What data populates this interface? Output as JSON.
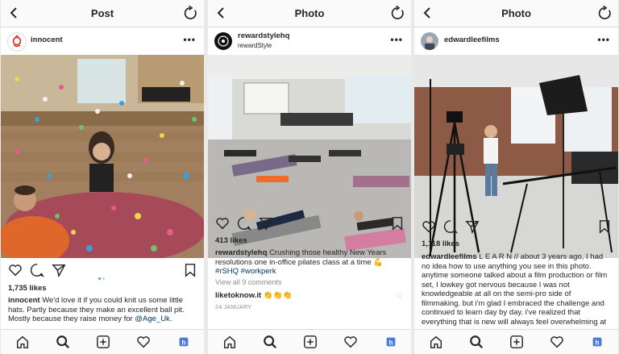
{
  "panels": [
    {
      "header_title": "Post",
      "username": "innocent",
      "likes": "1,735 likes",
      "caption_user": "innocent",
      "caption_text": "We'd love it if you could knit us some little hats. Partly because they make an excellent ball pit. Mostly because they raise money for",
      "caption_tag": "@Age_Uk",
      "caption_end": "."
    },
    {
      "header_title": "Photo",
      "username": "rewardstylehq",
      "subtitle": "rewardStyle",
      "likes": "413 likes",
      "caption_user": "rewardstylehq",
      "caption_text": "Crushing those healthy New Years resolutions one in-office pilates class at a time",
      "caption_tags": "#rSHQ #workperk",
      "view_all": "View all 9 comments",
      "comment_user": "liketoknow.it",
      "date": "24 JANUARY"
    },
    {
      "header_title": "Photo",
      "username": "edwardleefilms",
      "likes": "1,118 likes",
      "caption_user": "edwardleefilms",
      "caption_text": "L E A R N // about 3 years ago, I had no idea how to use anything you see in this photo. anytime someone talked about a film production or film set, I lowkey got nervous because I was not knowledgeable at all on the semi-pro side of filmmaking. but i'm glad I embraced the challenge and continued to learn day by day. i've realized that everything that is new will always feel overwhelming at first. if you're first starting out in anything, and you"
    }
  ],
  "colors": {
    "link": "#003569",
    "accent_blue": "#3897f0",
    "innocent_red": "#d9241c"
  },
  "icons": [
    "back-icon",
    "refresh-icon",
    "more-icon",
    "heart-icon",
    "comment-icon",
    "share-icon",
    "bookmark-icon",
    "home-icon",
    "search-icon",
    "add-icon",
    "activity-icon",
    "profile-icon"
  ]
}
